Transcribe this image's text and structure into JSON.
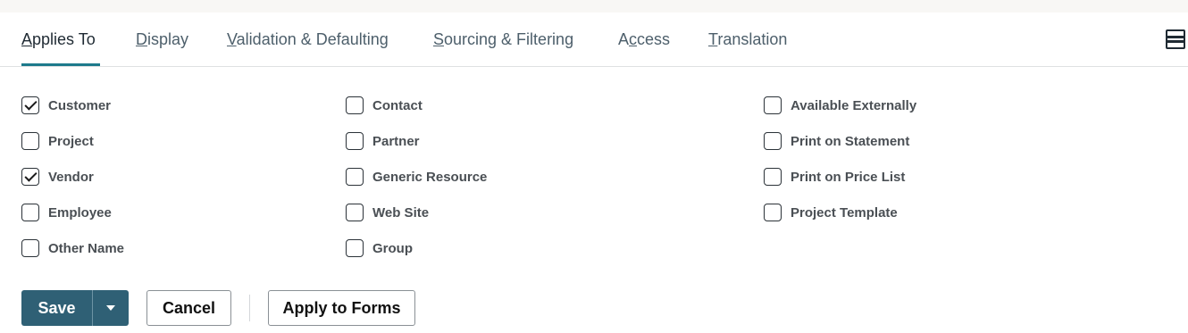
{
  "tabs": [
    {
      "key": "A",
      "rest": "pplies To",
      "active": true
    },
    {
      "key": "D",
      "rest": "isplay",
      "active": false
    },
    {
      "key": "V",
      "rest": "alidation & Defaulting",
      "active": false
    },
    {
      "key": "S",
      "rest": "ourcing & Filtering",
      "active": false
    },
    {
      "pre": "A",
      "key": "c",
      "rest": "cess",
      "active": false
    },
    {
      "key": "T",
      "rest": "ranslation",
      "active": false
    }
  ],
  "checkboxes": {
    "col1": [
      {
        "label": "Customer",
        "checked": true
      },
      {
        "label": "Project",
        "checked": false
      },
      {
        "label": "Vendor",
        "checked": true
      },
      {
        "label": "Employee",
        "checked": false
      },
      {
        "label": "Other Name",
        "checked": false
      }
    ],
    "col2": [
      {
        "label": "Contact",
        "checked": false
      },
      {
        "label": "Partner",
        "checked": false
      },
      {
        "label": "Generic Resource",
        "checked": false
      },
      {
        "label": "Web Site",
        "checked": false
      },
      {
        "label": "Group",
        "checked": false
      }
    ],
    "col3": [
      {
        "label": "Available Externally",
        "checked": false
      },
      {
        "label": "Print on Statement",
        "checked": false
      },
      {
        "label": "Print on Price List",
        "checked": false
      },
      {
        "label": "Project Template",
        "checked": false
      }
    ]
  },
  "buttons": {
    "save": "Save",
    "cancel": "Cancel",
    "apply": "Apply to Forms"
  },
  "icons": {
    "layout": "layout-toggle-icon",
    "save_menu": "chevron-down-icon"
  },
  "colors": {
    "primary_button": "#2f6075",
    "active_tab_underline": "#1d7a8c"
  }
}
